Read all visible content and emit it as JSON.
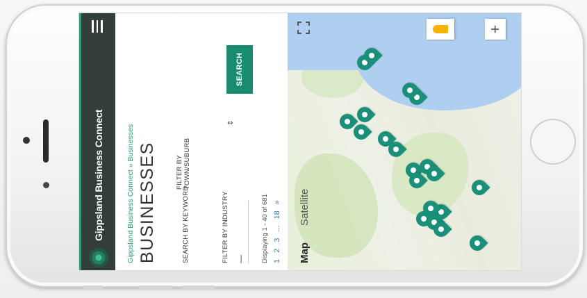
{
  "app": {
    "title": "Gippsland Business Connect",
    "breadcrumb": "Gippsland Business Connect » Businesses",
    "page_title": "BUSINESSES"
  },
  "filters": {
    "keyword_label": "SEARCH BY KEYWORD",
    "town_label": "FILTER BY TOWN/SUBURB",
    "town_caret": "⇕",
    "industry_label": "FILTER BY INDUSTRY",
    "industry_value": "—",
    "search_button": "SEARCH"
  },
  "results": {
    "displaying": "Displaying 1 - 40 of 681",
    "pages": [
      "1",
      "2",
      "3",
      "...",
      "18",
      "»"
    ]
  },
  "map": {
    "tab_map": "Map",
    "tab_satellite": "Satellite",
    "zoom_in": "+"
  },
  "colors": {
    "header_bg": "#333d3a",
    "accent": "#1a8c6e",
    "pin": "#19907a"
  }
}
